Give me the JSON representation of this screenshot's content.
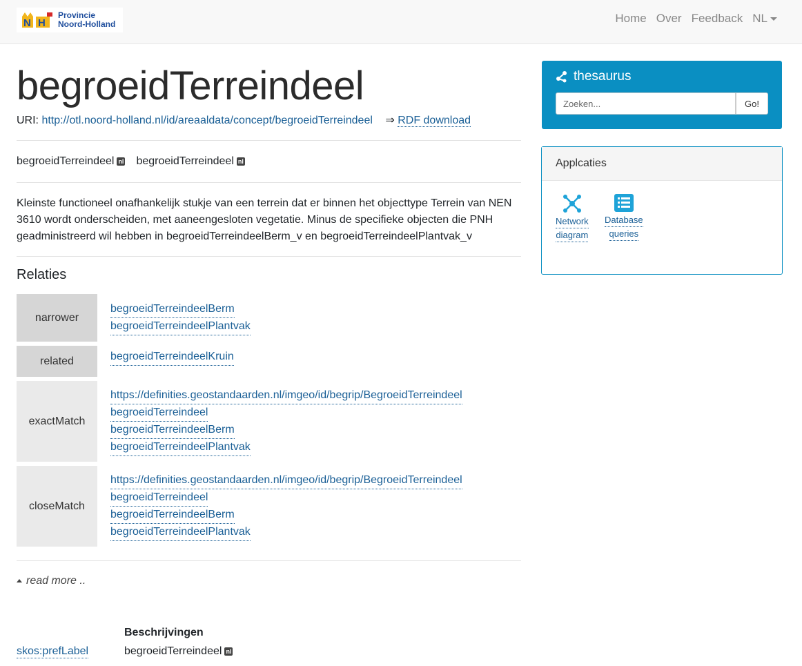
{
  "nav": {
    "logo_line1": "Provincie",
    "logo_line2": "Noord-Holland",
    "links": [
      "Home",
      "Over",
      "Feedback"
    ],
    "lang": "NL"
  },
  "concept": {
    "title": "begroeidTerreindeel",
    "uri_label": "URI:",
    "uri": "http://otl.noord-holland.nl/id/areaaldata/concept/begroeidTerreindeel",
    "rdf_arrow": "⇒",
    "rdf_label": "RDF download",
    "labels": [
      "begroeidTerreindeel",
      "begroeidTerreindeel"
    ],
    "lang_badge": "nl",
    "definition": "Kleinste functioneel onafhankelijk stukje van een terrein dat er binnen het objecttype Terrein van NEN 3610 wordt onderscheiden, met aaneengesloten vegetatie. Minus de specifieke objecten die PNH geadministreerd wil hebben in begroeidTerreindeelBerm_v en begroeidTerreindeelPlantvak_v"
  },
  "relaties": {
    "title": "Relaties",
    "rows": [
      {
        "key": "narrower",
        "values": [
          "begroeidTerreindeelBerm",
          "begroeidTerreindeelPlantvak"
        ]
      },
      {
        "key": "related",
        "values": [
          "begroeidTerreindeelKruin"
        ]
      },
      {
        "key": "exactMatch",
        "values": [
          "https://definities.geostandaarden.nl/imgeo/id/begrip/BegroeidTerreindeel",
          "begroeidTerreindeel",
          "begroeidTerreindeelBerm",
          "begroeidTerreindeelPlantvak"
        ]
      },
      {
        "key": "closeMatch",
        "values": [
          "https://definities.geostandaarden.nl/imgeo/id/begrip/BegroeidTerreindeel",
          "begroeidTerreindeel",
          "begroeidTerreindeelBerm",
          "begroeidTerreindeelPlantvak"
        ]
      }
    ]
  },
  "readmore": "read more ..",
  "descriptions": {
    "header": "Beschrijvingen",
    "key": "skos:prefLabel",
    "value": "begroeidTerreindeel"
  },
  "sidebar": {
    "thesaurus_title": "thesaurus",
    "search_placeholder": "Zoeken...",
    "go_label": "Go!",
    "apps_title": "Applcaties",
    "apps": [
      {
        "line1": "Network",
        "line2": "diagram",
        "icon": "network-icon"
      },
      {
        "line1": "Database",
        "line2": "queries",
        "icon": "list-icon"
      }
    ]
  },
  "colors": {
    "accent": "#0a8fc2",
    "link": "#1a5f96"
  }
}
